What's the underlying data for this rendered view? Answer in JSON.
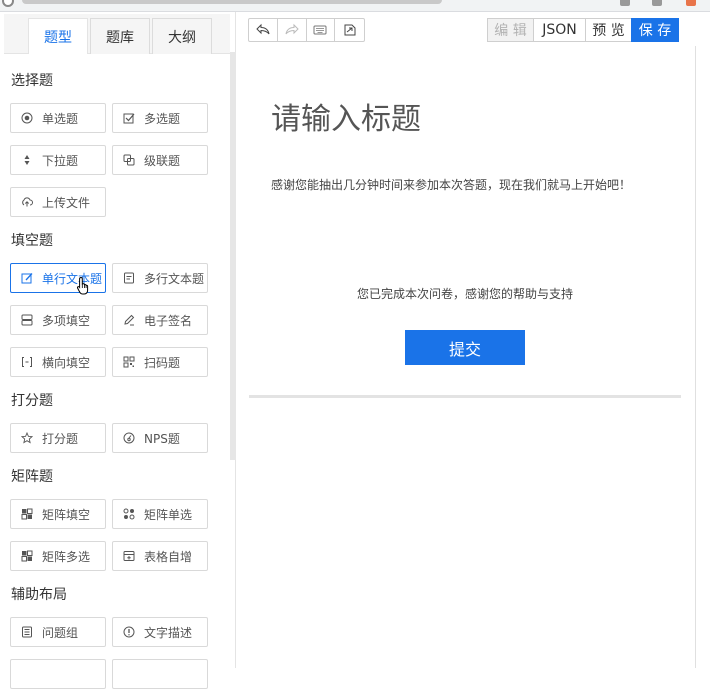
{
  "tabs": [
    "题型",
    "题库",
    "大纲"
  ],
  "sections": {
    "choice": "选择题",
    "fill": "填空题",
    "score": "打分题",
    "matrix": "矩阵题",
    "layout": "辅助布局"
  },
  "questions": {
    "single_choice": "单选题",
    "multi_choice": "多选题",
    "dropdown": "下拉题",
    "cascade": "级联题",
    "upload": "上传文件",
    "single_line": "单行文本题",
    "multi_line": "多行文本题",
    "multi_fill": "多项填空",
    "signature": "电子签名",
    "horizontal_fill": "横向填空",
    "scan": "扫码题",
    "rating": "打分题",
    "nps": "NPS题",
    "matrix_fill": "矩阵填空",
    "matrix_single": "矩阵单选",
    "matrix_multi": "矩阵多选",
    "table_add": "表格自增",
    "question_group": "问题组",
    "text_desc": "文字描述"
  },
  "toolbar": {
    "edit": "编 辑",
    "json": "JSON",
    "preview": "预 览",
    "save": "保 存"
  },
  "form": {
    "title": "请输入标题",
    "description": "感谢您能抽出几分钟时间来参加本次答题，现在我们就马上开始吧！",
    "end_message": "您已完成本次问卷，感谢您的帮助与支持",
    "submit": "提交"
  },
  "colors": {
    "accent": "#1a73e8",
    "border": "#d9d9d9"
  }
}
